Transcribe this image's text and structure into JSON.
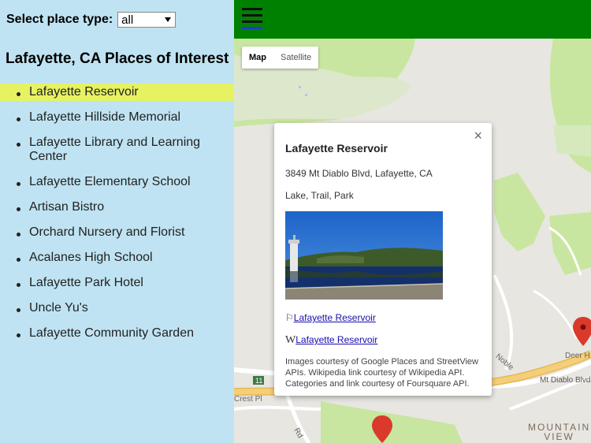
{
  "filter": {
    "label": "Select place type:",
    "selected": "all"
  },
  "sidebar": {
    "title": "Lafayette, CA Places of Interest",
    "places": [
      "Lafayette Reservoir",
      "Lafayette Hillside Memorial",
      "Lafayette Library and Learning Center",
      "Lafayette Elementary School",
      "Artisan Bistro",
      "Orchard Nursery and Florist",
      "Acalanes High School",
      "Lafayette Park Hotel",
      "Uncle Yu's",
      "Lafayette Community Garden"
    ]
  },
  "map": {
    "type_buttons": {
      "map": "Map",
      "satellite": "Satellite"
    },
    "labels": {
      "route": "11",
      "crest": "Crest Pl",
      "diablo": "Mt Diablo Blvd",
      "deer": "Deer H",
      "noble": "Noble",
      "rd": "Rd",
      "mountain": "MOUNTAIN",
      "view": "VIEW"
    }
  },
  "info_window": {
    "close": "×",
    "title": "Lafayette Reservoir",
    "address": "3849 Mt Diablo Blvd, Lafayette, CA",
    "categories": "Lake, Trail, Park",
    "places_link": "Lafayette Reservoir",
    "wiki_glyph": "W",
    "wiki_link": "Lafayette Reservoir",
    "credits": "Images courtesy of Google Places and StreetView APIs. Wikipedia link courtesy of Wikipedia API. Categories and link courtesy of Foursquare API."
  },
  "colors": {
    "sidebar_bg": "#bfe3f2",
    "header_bg": "#008000",
    "highlight": "#e6f261",
    "park": "#c8e6a0",
    "marker": "#d93a2b",
    "highway": "#f4cf7a"
  }
}
